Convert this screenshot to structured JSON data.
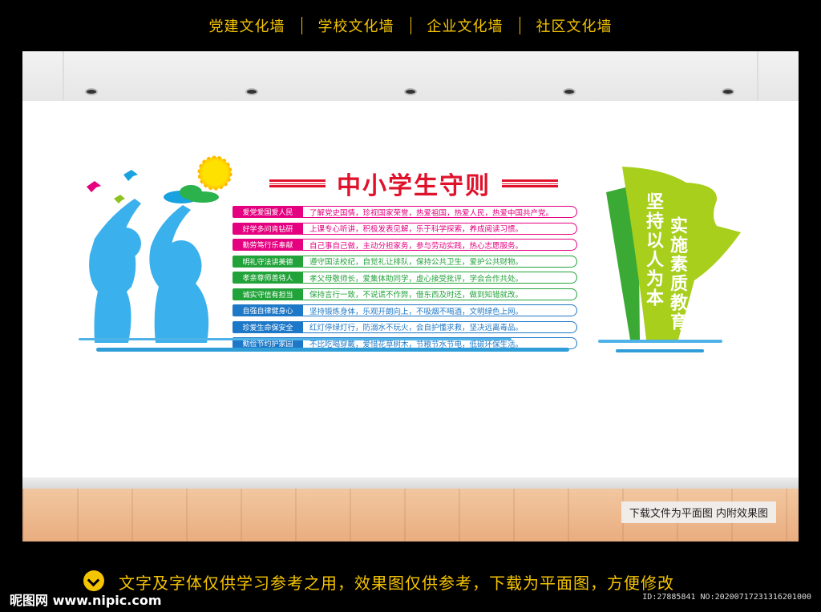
{
  "top_nav": [
    "党建文化墙",
    "学校文化墙",
    "企业文化墙",
    "社区文化墙"
  ],
  "title": "中小学生守则",
  "rules": [
    {
      "tag": "爱党爱国爱人民",
      "text": "了解党史国情，珍视国家荣誉，热爱祖国，热爱人民，热爱中国共产党。",
      "color": "#e4007f"
    },
    {
      "tag": "好学多问肯钻研",
      "text": "上课专心听讲，积极发表见解，乐于科学探索，养成阅读习惯。",
      "color": "#e4007f"
    },
    {
      "tag": "勤劳笃行乐奉献",
      "text": "自己事自己做，主动分担家务，参与劳动实践，热心志愿服务。",
      "color": "#e4007f"
    },
    {
      "tag": "明礼守法讲美德",
      "text": "遵守国法校纪，自觉礼让排队，保持公共卫生，爱护公共财物。",
      "color": "#22a33a"
    },
    {
      "tag": "孝亲尊师善待人",
      "text": "孝父母敬师长，爱集体助同学，虚心接受批评，学会合作共处。",
      "color": "#22a33a"
    },
    {
      "tag": "诚实守信有担当",
      "text": "保持言行一致，不说谎不作弊，借东西及时还，做到知错就改。",
      "color": "#22a33a"
    },
    {
      "tag": "自强自律健身心",
      "text": "坚持锻炼身体，乐观开朗向上，不吸烟不喝酒，文明绿色上网。",
      "color": "#1e78c8"
    },
    {
      "tag": "珍爱生命保安全",
      "text": "红灯停绿灯行，防溺水不玩火，会自护懂求救，坚决远离毒品。",
      "color": "#1e78c8"
    },
    {
      "tag": "勤俭节约护家园",
      "text": "不比吃喝穿戴，爱惜花草树木，节粮节水节电，低碳环保生活。",
      "color": "#1e78c8"
    }
  ],
  "slogan_line1": "坚持以人为本",
  "slogan_line2": "实施素质教育",
  "floor_note": "下载文件为平面图 内附效果图",
  "notice": "文字及字体仅供学习参考之用，效果图仅供参考，下载为平面图，方便修改",
  "site_logo": "昵图网 www.nipic.com",
  "image_id": "ID:27885841 NO:20200717231316201000",
  "colors": {
    "accent_yellow": "#f5c400",
    "title_red": "#e0112b",
    "silhouette_blue": "#3ab0ec",
    "green_dark": "#3aaa35",
    "green_light": "#a8cf1c"
  }
}
